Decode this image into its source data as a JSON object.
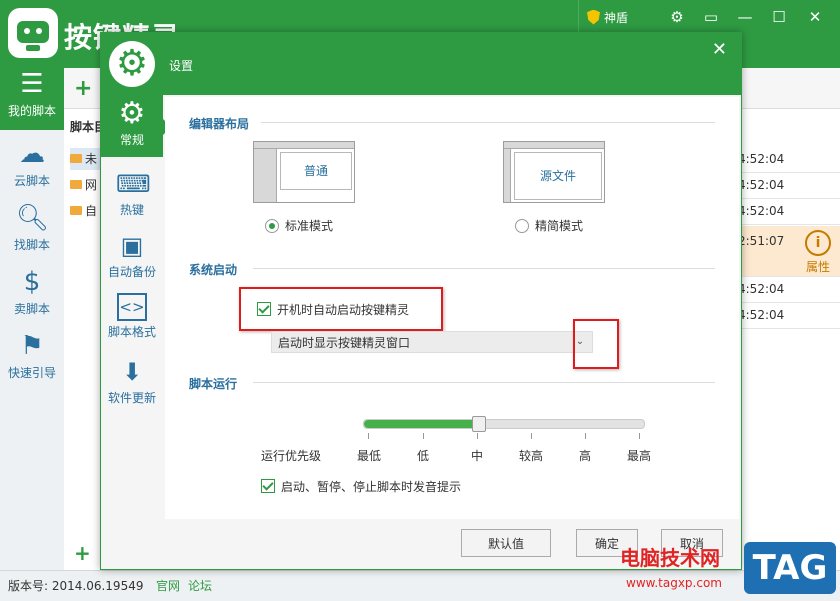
{
  "app": {
    "title": "按键精灵",
    "shield": "神盾",
    "version": "版本号: 2014.06.19549",
    "link_site": "官网",
    "link_forum": "论坛"
  },
  "nav": [
    {
      "label": "我的脚本",
      "icon": "list-icon"
    },
    {
      "label": "云脚本",
      "icon": "cloud-icon"
    },
    {
      "label": "找脚本",
      "icon": "search-icon"
    },
    {
      "label": "卖脚本",
      "icon": "dollar-icon"
    },
    {
      "label": "快速引导",
      "icon": "signpost-icon"
    }
  ],
  "list": {
    "header": "脚本目",
    "items": [
      "未",
      "网",
      "自"
    ]
  },
  "right": {
    "times": [
      "4:52:04",
      "4:52:04",
      "4:52:04",
      "2:51:07",
      "4:52:04",
      "4:52:04"
    ],
    "property": "属性"
  },
  "dialog": {
    "title": "设置",
    "close": "✕",
    "sidebar": [
      {
        "label": "常规",
        "icon": "gear-icon"
      },
      {
        "label": "热键",
        "icon": "keyboard-icon"
      },
      {
        "label": "自动备份",
        "icon": "save-icon"
      },
      {
        "label": "脚本格式",
        "icon": "code-icon"
      },
      {
        "label": "软件更新",
        "icon": "download-icon"
      }
    ],
    "editor_layout": {
      "title": "编辑器布局",
      "normal_box": "普通",
      "source_box": "源文件",
      "standard_mode": "标准模式",
      "simple_mode": "精简模式",
      "selected": "标准模式"
    },
    "startup": {
      "title": "系统启动",
      "autostart_label": "开机时自动启动按键精灵",
      "autostart_checked": true,
      "dropdown_value": "启动时显示按键精灵窗口"
    },
    "script_run": {
      "title": "脚本运行",
      "priority_label": "运行优先级",
      "levels": [
        "最低",
        "低",
        "中",
        "较高",
        "高",
        "最高"
      ],
      "priority_value": "中",
      "sound_label": "启动、暂停、停止脚本时发音提示",
      "sound_checked": true
    },
    "buttons": {
      "default": "默认值",
      "ok": "确定",
      "cancel": "取消"
    }
  },
  "watermark": {
    "text": "电脑技术网",
    "url": "www.tagxp.com",
    "tag": "TAG"
  },
  "colors": {
    "brand": "#2e9b42",
    "link": "#2a6f9e",
    "highlight": "#e01b1b"
  }
}
